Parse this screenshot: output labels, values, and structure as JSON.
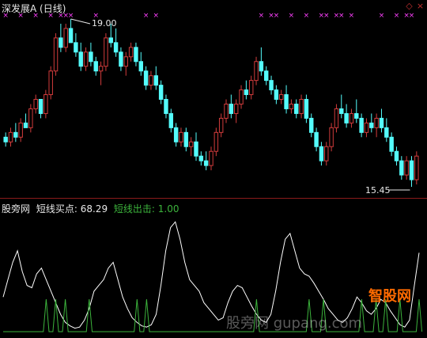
{
  "chart_title": {
    "name": "深发展A",
    "period": "(日线)"
  },
  "window_buttons": {
    "restore": "◇",
    "close": "×"
  },
  "price_annotations": {
    "high": "19.00",
    "low": "15.45"
  },
  "indicator_title": {
    "name": "股旁网",
    "line1_label": "短线买点:",
    "line1_value": "68.29",
    "line2_label": "短线出击:",
    "line2_value": "1.00"
  },
  "watermark": {
    "text": "股旁网 gupang.com",
    "logo": "智股网"
  },
  "colors": {
    "background": "#000000",
    "up_candle": "#d23c3c",
    "down_candle": "#54fcfc",
    "signal_mark": "#ff40ff",
    "line1": "#ffffff",
    "line2": "#3cb43c",
    "separator": "#8b1a1a"
  },
  "chart_data": [
    {
      "type": "candlestick",
      "title": "深发展A (日线)",
      "annotations": [
        {
          "label": "19.00",
          "kind": "high"
        },
        {
          "label": "15.45",
          "kind": "low"
        }
      ],
      "candles": [
        [
          16.5,
          16.6,
          16.3,
          16.4
        ],
        [
          16.4,
          16.7,
          16.3,
          16.6
        ],
        [
          16.6,
          16.8,
          16.4,
          16.5
        ],
        [
          16.5,
          16.9,
          16.4,
          16.8
        ],
        [
          16.8,
          17.0,
          16.7,
          16.7
        ],
        [
          16.7,
          17.2,
          16.6,
          17.1
        ],
        [
          17.1,
          17.4,
          17.0,
          17.3
        ],
        [
          17.3,
          17.3,
          16.9,
          17.0
        ],
        [
          17.0,
          17.5,
          16.9,
          17.4
        ],
        [
          17.4,
          18.0,
          17.3,
          17.9
        ],
        [
          17.9,
          18.7,
          17.8,
          18.6
        ],
        [
          18.6,
          18.9,
          18.3,
          18.4
        ],
        [
          18.4,
          18.9,
          18.3,
          18.8
        ],
        [
          18.8,
          19.0,
          18.5,
          18.5
        ],
        [
          18.5,
          18.7,
          18.2,
          18.3
        ],
        [
          18.3,
          18.5,
          17.9,
          18.0
        ],
        [
          18.0,
          18.4,
          17.9,
          18.3
        ],
        [
          18.3,
          18.5,
          18.0,
          18.1
        ],
        [
          18.1,
          18.2,
          17.8,
          17.9
        ],
        [
          17.9,
          18.1,
          17.6,
          18.0
        ],
        [
          18.0,
          18.7,
          17.9,
          18.6
        ],
        [
          18.6,
          18.9,
          18.4,
          18.5
        ],
        [
          18.5,
          18.8,
          18.2,
          18.3
        ],
        [
          18.3,
          18.4,
          17.9,
          18.0
        ],
        [
          18.0,
          18.3,
          17.8,
          18.2
        ],
        [
          18.2,
          18.5,
          18.1,
          18.4
        ],
        [
          18.4,
          18.5,
          18.0,
          18.1
        ],
        [
          18.1,
          18.3,
          17.8,
          17.9
        ],
        [
          17.9,
          18.0,
          17.5,
          17.6
        ],
        [
          17.6,
          17.9,
          17.5,
          17.8
        ],
        [
          17.8,
          18.0,
          17.5,
          17.6
        ],
        [
          17.6,
          17.7,
          17.2,
          17.3
        ],
        [
          17.3,
          17.4,
          16.9,
          17.0
        ],
        [
          17.0,
          17.1,
          16.6,
          16.7
        ],
        [
          16.7,
          16.8,
          16.3,
          16.4
        ],
        [
          16.4,
          16.7,
          16.3,
          16.6
        ],
        [
          16.6,
          16.7,
          16.2,
          16.3
        ],
        [
          16.3,
          16.5,
          16.1,
          16.4
        ],
        [
          16.4,
          16.6,
          16.0,
          16.1
        ],
        [
          16.1,
          16.2,
          15.9,
          16.0
        ],
        [
          16.0,
          16.2,
          15.8,
          15.9
        ],
        [
          15.9,
          16.3,
          15.8,
          16.2
        ],
        [
          16.2,
          16.7,
          16.1,
          16.6
        ],
        [
          16.6,
          17.0,
          16.5,
          16.9
        ],
        [
          16.9,
          17.3,
          16.8,
          17.2
        ],
        [
          17.2,
          17.4,
          16.9,
          17.0
        ],
        [
          17.0,
          17.3,
          16.8,
          17.2
        ],
        [
          17.2,
          17.6,
          17.1,
          17.5
        ],
        [
          17.5,
          17.7,
          17.3,
          17.4
        ],
        [
          17.4,
          17.8,
          17.3,
          17.7
        ],
        [
          17.7,
          18.2,
          17.6,
          18.1
        ],
        [
          18.1,
          18.4,
          17.8,
          17.9
        ],
        [
          17.9,
          18.0,
          17.6,
          17.7
        ],
        [
          17.7,
          17.8,
          17.4,
          17.5
        ],
        [
          17.5,
          17.6,
          17.2,
          17.3
        ],
        [
          17.3,
          17.5,
          17.2,
          17.4
        ],
        [
          17.4,
          17.6,
          17.0,
          17.1
        ],
        [
          17.1,
          17.3,
          17.0,
          17.2
        ],
        [
          17.2,
          17.3,
          16.9,
          17.0
        ],
        [
          17.0,
          17.4,
          16.9,
          17.3
        ],
        [
          17.3,
          17.4,
          16.8,
          16.9
        ],
        [
          16.9,
          17.0,
          16.5,
          16.6
        ],
        [
          16.6,
          16.7,
          16.2,
          16.3
        ],
        [
          16.3,
          16.4,
          15.9,
          16.0
        ],
        [
          16.0,
          16.4,
          15.9,
          16.3
        ],
        [
          16.3,
          16.8,
          16.2,
          16.7
        ],
        [
          16.7,
          17.2,
          16.6,
          17.1
        ],
        [
          17.1,
          17.4,
          16.9,
          17.0
        ],
        [
          17.0,
          17.2,
          16.7,
          16.8
        ],
        [
          16.8,
          17.1,
          16.7,
          17.0
        ],
        [
          17.0,
          17.3,
          16.8,
          16.9
        ],
        [
          16.9,
          17.0,
          16.5,
          16.6
        ],
        [
          16.6,
          16.9,
          16.5,
          16.8
        ],
        [
          16.8,
          17.0,
          16.6,
          16.7
        ],
        [
          16.7,
          17.0,
          16.5,
          16.9
        ],
        [
          16.9,
          17.1,
          16.6,
          16.7
        ],
        [
          16.7,
          16.9,
          16.4,
          16.5
        ],
        [
          16.5,
          16.6,
          16.1,
          16.2
        ],
        [
          16.2,
          16.3,
          15.9,
          16.0
        ],
        [
          16.0,
          16.1,
          15.6,
          15.7
        ],
        [
          15.7,
          16.1,
          15.6,
          16.0
        ],
        [
          16.0,
          16.1,
          15.45,
          15.6
        ],
        [
          15.6,
          16.2,
          15.5,
          16.1
        ]
      ],
      "signal_marks": "×"
    },
    {
      "type": "line",
      "title": "股旁网",
      "series": [
        {
          "name": "短线买点",
          "last_value": 68.29,
          "values": [
            30,
            45,
            60,
            70,
            52,
            40,
            38,
            50,
            55,
            45,
            35,
            25,
            15,
            8,
            5,
            3,
            4,
            10,
            20,
            35,
            40,
            45,
            55,
            60,
            45,
            30,
            20,
            12,
            8,
            5,
            4,
            6,
            15,
            40,
            70,
            90,
            95,
            80,
            60,
            45,
            40,
            35,
            25,
            20,
            15,
            10,
            12,
            25,
            35,
            40,
            38,
            30,
            22,
            15,
            10,
            8,
            15,
            35,
            60,
            80,
            85,
            70,
            55,
            50,
            48,
            42,
            35,
            28,
            20,
            15,
            10,
            8,
            12,
            20,
            30,
            25,
            18,
            15,
            20,
            28,
            25,
            18,
            12,
            6,
            4,
            10,
            40,
            68.29
          ]
        },
        {
          "name": "短线出击",
          "last_value": 1.0,
          "values": [
            0,
            0,
            0,
            0,
            0,
            0,
            0,
            0,
            0,
            1,
            0,
            1,
            0,
            1,
            0,
            0,
            0,
            0,
            1,
            0,
            0,
            0,
            0,
            0,
            0,
            0,
            0,
            0,
            1,
            0,
            1,
            0,
            0,
            0,
            0,
            0,
            0,
            0,
            0,
            0,
            0,
            0,
            0,
            0,
            0,
            0,
            0,
            0,
            0,
            0,
            0,
            0,
            0,
            1,
            0,
            0,
            0,
            0,
            0,
            0,
            0,
            0,
            0,
            0,
            1,
            0,
            0,
            1,
            0,
            0,
            0,
            0,
            0,
            0,
            0,
            1,
            0,
            0,
            1,
            0,
            1,
            0,
            0,
            1,
            0,
            0,
            0,
            1
          ]
        }
      ]
    }
  ]
}
